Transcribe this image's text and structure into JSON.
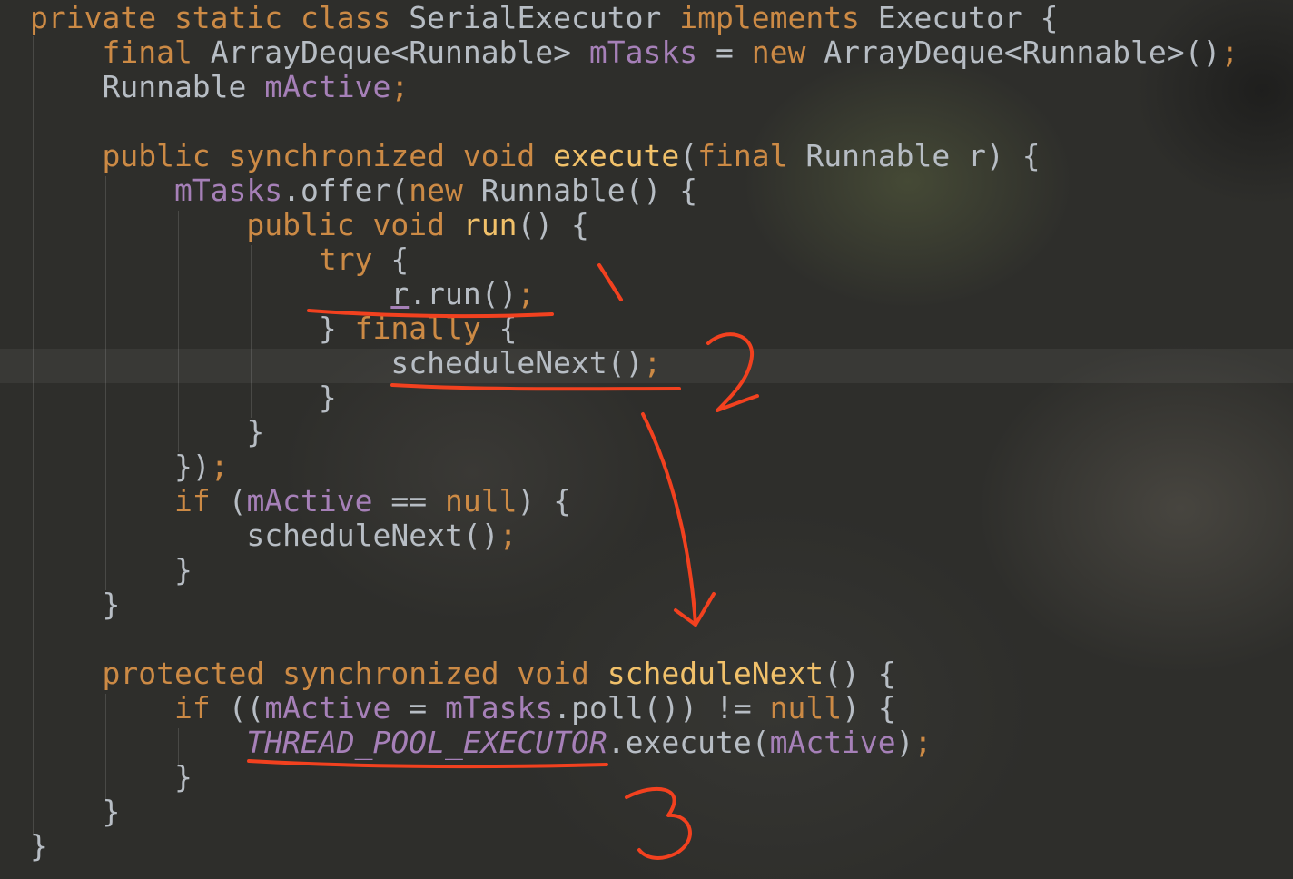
{
  "code": {
    "lines": [
      [
        {
          "t": "private static class ",
          "c": "kw"
        },
        {
          "t": "SerialExecutor ",
          "c": "pl"
        },
        {
          "t": "implements ",
          "c": "kw"
        },
        {
          "t": "Executor {",
          "c": "pl"
        }
      ],
      [
        {
          "t": "    final ",
          "c": "kw"
        },
        {
          "t": "ArrayDeque<Runnable> ",
          "c": "pl"
        },
        {
          "t": "mTasks",
          "c": "fld"
        },
        {
          "t": " = ",
          "c": "pl"
        },
        {
          "t": "new ",
          "c": "kw"
        },
        {
          "t": "ArrayDeque<Runnable>()",
          "c": "pl"
        },
        {
          "t": ";",
          "c": "kw"
        }
      ],
      [
        {
          "t": "    Runnable ",
          "c": "pl"
        },
        {
          "t": "mActive",
          "c": "fld"
        },
        {
          "t": ";",
          "c": "kw"
        }
      ],
      [],
      [
        {
          "t": "    public synchronized void ",
          "c": "kw"
        },
        {
          "t": "execute",
          "c": "fn"
        },
        {
          "t": "(",
          "c": "pl"
        },
        {
          "t": "final ",
          "c": "kw"
        },
        {
          "t": "Runnable r) {",
          "c": "pl"
        }
      ],
      [
        {
          "t": "        ",
          "c": "pl"
        },
        {
          "t": "mTasks",
          "c": "fld"
        },
        {
          "t": ".offer(",
          "c": "pl"
        },
        {
          "t": "new ",
          "c": "kw"
        },
        {
          "t": "Runnable() {",
          "c": "pl"
        }
      ],
      [
        {
          "t": "            public void ",
          "c": "kw"
        },
        {
          "t": "run",
          "c": "fn"
        },
        {
          "t": "() {",
          "c": "pl"
        }
      ],
      [
        {
          "t": "                try ",
          "c": "kw"
        },
        {
          "t": "{",
          "c": "pl"
        }
      ],
      [
        {
          "t": "                    ",
          "c": "pl"
        },
        {
          "t": "r",
          "c": "under"
        },
        {
          "t": ".run()",
          "c": "pl"
        },
        {
          "t": ";",
          "c": "kw"
        }
      ],
      [
        {
          "t": "                } ",
          "c": "pl"
        },
        {
          "t": "finally ",
          "c": "kw"
        },
        {
          "t": "{",
          "c": "pl"
        }
      ],
      [
        {
          "t": "                    scheduleNext()",
          "c": "pl"
        },
        {
          "t": ";",
          "c": "kw"
        }
      ],
      [
        {
          "t": "                }",
          "c": "pl"
        }
      ],
      [
        {
          "t": "            }",
          "c": "pl"
        }
      ],
      [
        {
          "t": "        })",
          "c": "pl"
        },
        {
          "t": ";",
          "c": "kw"
        }
      ],
      [
        {
          "t": "        ",
          "c": "pl"
        },
        {
          "t": "if ",
          "c": "kw"
        },
        {
          "t": "(",
          "c": "pl"
        },
        {
          "t": "mActive",
          "c": "fld"
        },
        {
          "t": " == ",
          "c": "pl"
        },
        {
          "t": "null",
          "c": "kw"
        },
        {
          "t": ") {",
          "c": "pl"
        }
      ],
      [
        {
          "t": "            scheduleNext()",
          "c": "pl"
        },
        {
          "t": ";",
          "c": "kw"
        }
      ],
      [
        {
          "t": "        }",
          "c": "pl"
        }
      ],
      [
        {
          "t": "    }",
          "c": "pl"
        }
      ],
      [],
      [
        {
          "t": "    protected synchronized void ",
          "c": "kw"
        },
        {
          "t": "scheduleNext",
          "c": "fn"
        },
        {
          "t": "() {",
          "c": "pl"
        }
      ],
      [
        {
          "t": "        ",
          "c": "pl"
        },
        {
          "t": "if ",
          "c": "kw"
        },
        {
          "t": "((",
          "c": "pl"
        },
        {
          "t": "mActive",
          "c": "fld"
        },
        {
          "t": " = ",
          "c": "pl"
        },
        {
          "t": "mTasks",
          "c": "fld"
        },
        {
          "t": ".poll()) != ",
          "c": "pl"
        },
        {
          "t": "null",
          "c": "kw"
        },
        {
          "t": ") {",
          "c": "pl"
        }
      ],
      [
        {
          "t": "            ",
          "c": "pl"
        },
        {
          "t": "THREAD_POOL_EXECUTOR",
          "c": "static-fld"
        },
        {
          "t": ".execute(",
          "c": "pl"
        },
        {
          "t": "mActive",
          "c": "fld"
        },
        {
          "t": ")",
          "c": "pl"
        },
        {
          "t": ";",
          "c": "kw"
        }
      ],
      [
        {
          "t": "        }",
          "c": "pl"
        }
      ],
      [
        {
          "t": "    }",
          "c": "pl"
        }
      ],
      [
        {
          "t": "}",
          "c": "pl"
        }
      ]
    ]
  },
  "annotations": {
    "color": "#f2411f",
    "labels": [
      "1",
      "2",
      "3"
    ]
  },
  "theme": {
    "keyword": "#cc8a45",
    "field": "#a680b8",
    "method": "#f1c16a",
    "plain": "#b7bdc4"
  }
}
